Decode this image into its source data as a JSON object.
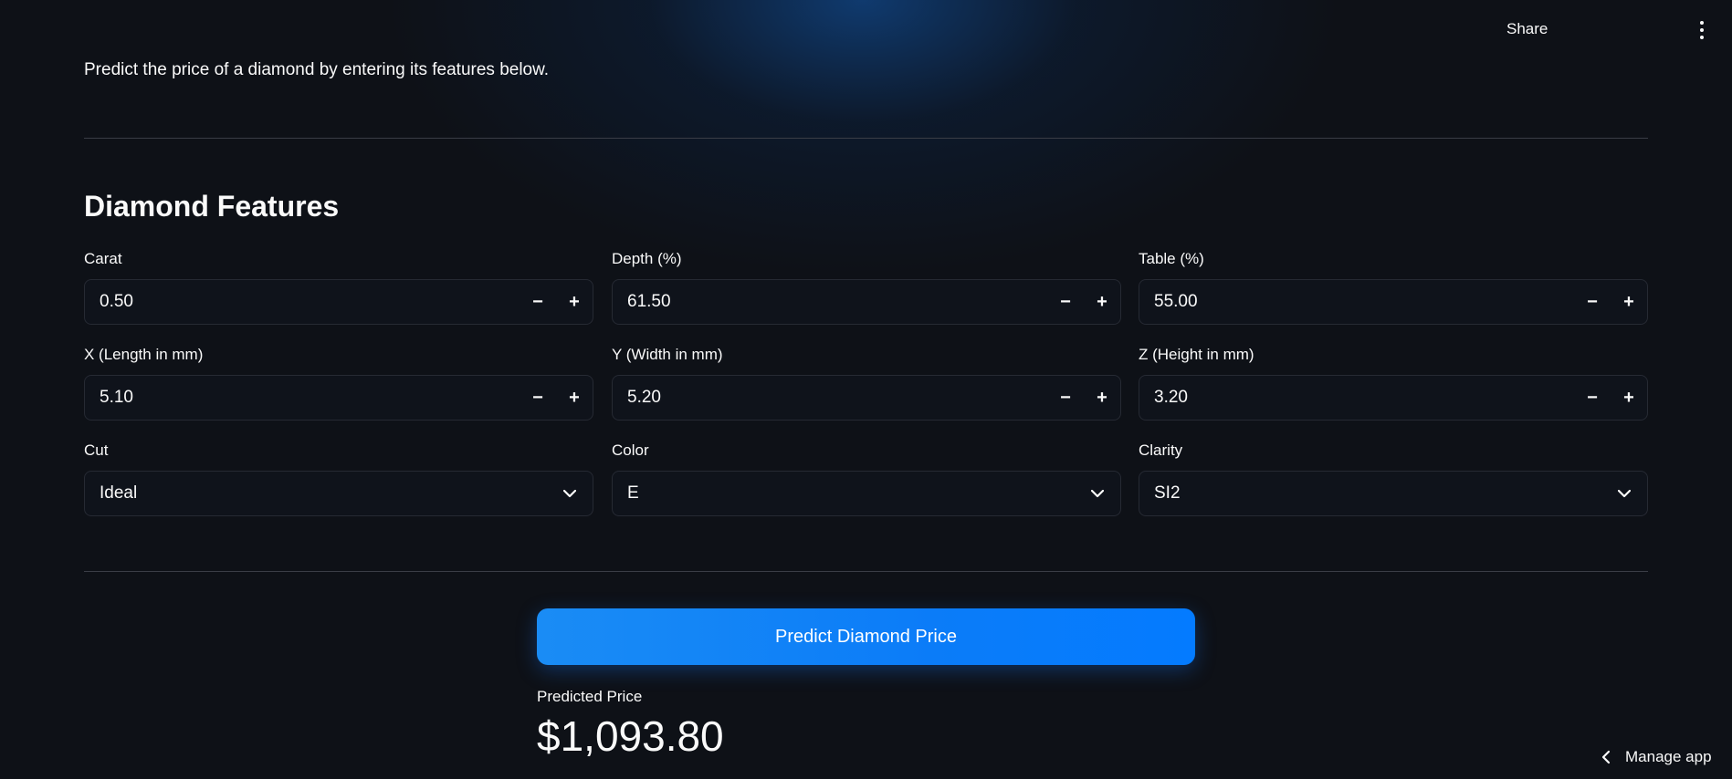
{
  "header": {
    "share_label": "Share",
    "menu_icon": "more-vertical-icon"
  },
  "subtitle": "Predict the price of a diamond by entering its features below.",
  "section_title": "Diamond Features",
  "fields": {
    "carat": {
      "label": "Carat",
      "value": "0.50"
    },
    "depth": {
      "label": "Depth (%)",
      "value": "61.50"
    },
    "table": {
      "label": "Table (%)",
      "value": "55.00"
    },
    "x": {
      "label": "X (Length in mm)",
      "value": "5.10"
    },
    "y": {
      "label": "Y (Width in mm)",
      "value": "5.20"
    },
    "z": {
      "label": "Z (Height in mm)",
      "value": "3.20"
    },
    "cut": {
      "label": "Cut",
      "value": "Ideal"
    },
    "color": {
      "label": "Color",
      "value": "E"
    },
    "clarity": {
      "label": "Clarity",
      "value": "SI2"
    }
  },
  "stepper": {
    "minus": "−",
    "plus": "+"
  },
  "predict_button": "Predict Diamond Price",
  "result": {
    "label": "Predicted Price",
    "value": "$1,093.80"
  },
  "footer": {
    "manage_label": "Manage app"
  },
  "colors": {
    "background": "#0e1117",
    "accent": "#0b7cf8",
    "border": "#262a33",
    "text": "#fafafa"
  }
}
